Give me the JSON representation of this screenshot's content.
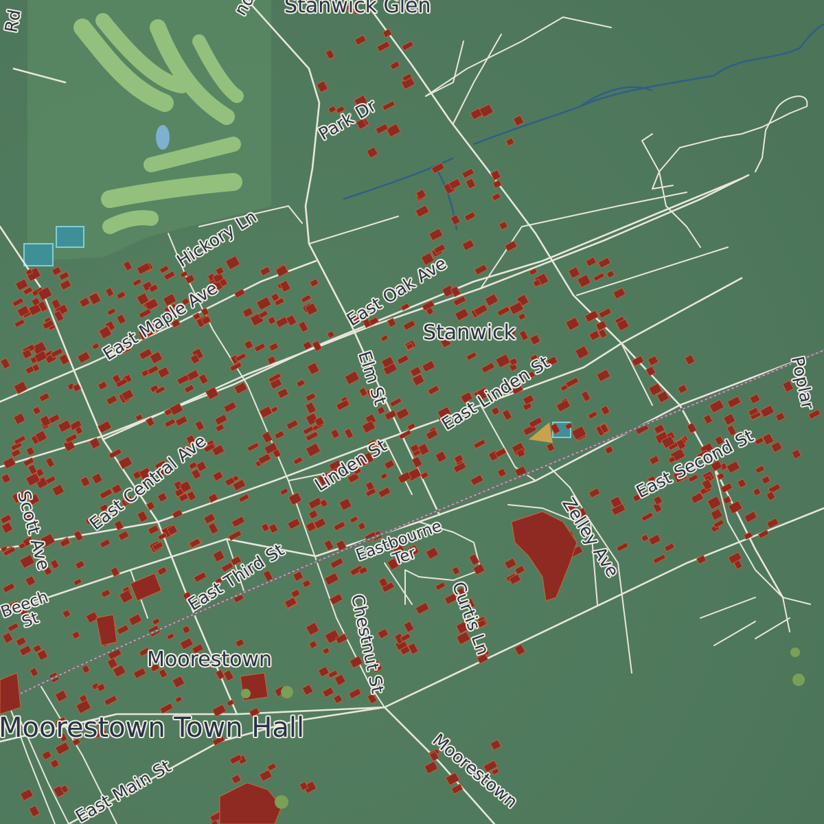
{
  "colors": {
    "land": "#4f7a5c",
    "land_dark": "#3f6a52",
    "road": "#e9e6dc",
    "building": "#8e2a22",
    "building_edge": "#c76a3a",
    "water": "#2f5f86",
    "golf": "#88b873",
    "label_text": "#27344a",
    "label_halo": "#f3eee0"
  },
  "places": {
    "stanwick_glen": "Stanwick Glen",
    "stanwick": "Stanwick",
    "moorestown": "Moorestown",
    "town_hall": "Moorestown Town Hall"
  },
  "roads": {
    "park_dr": "Park Dr",
    "hickory_ln": "Hickory Ln",
    "east_maple_ave": "East Maple Ave",
    "east_oak_ave": "East Oak Ave",
    "elm_st": "Elm St",
    "east_linden_st": "East Linden St",
    "linden_st": "Linden St",
    "east_central_ave": "East Central Ave",
    "east_second_st": "East Second St",
    "east_third_st": "East Third St",
    "eastbourne_ter": "Eastbourne Ter",
    "curtis_ln": "Curtis Ln",
    "zelley_ave": "Zelley Ave",
    "chestnut_st": "Chestnut St",
    "beech_st": "Beech St",
    "scott_ave": "Scott Ave",
    "east_main_st": "East Main St",
    "moorestown_rd": "Moorestown",
    "poplar": "Poplar",
    "top_left_rd": "Rd",
    "top_rd": "nd"
  }
}
